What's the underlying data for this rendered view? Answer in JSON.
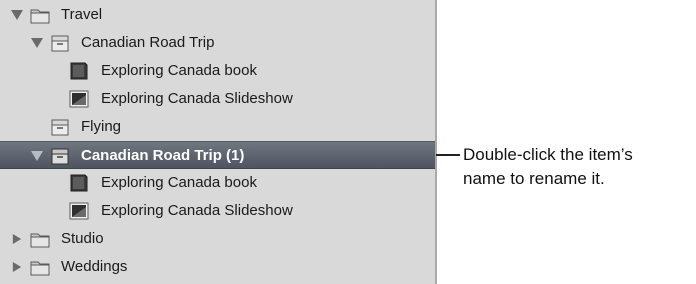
{
  "tree": {
    "items": [
      {
        "label": "Travel",
        "icon": "folder-icon",
        "expander": "expanded"
      },
      {
        "label": "Canadian Road Trip",
        "icon": "project-box-icon",
        "expander": "expanded"
      },
      {
        "label": "Exploring Canada book",
        "icon": "book-icon",
        "expander": "none"
      },
      {
        "label": "Exploring Canada Slideshow",
        "icon": "slideshow-icon",
        "expander": "none"
      },
      {
        "label": "Flying",
        "icon": "project-box-icon",
        "expander": "none"
      },
      {
        "label": "Canadian Road Trip (1)",
        "icon": "project-box-icon",
        "expander": "expanded",
        "selected": true
      },
      {
        "label": "Exploring Canada book",
        "icon": "book-icon",
        "expander": "none"
      },
      {
        "label": "Exploring Canada Slideshow",
        "icon": "slideshow-icon",
        "expander": "none"
      },
      {
        "label": "Studio",
        "icon": "folder-icon",
        "expander": "collapsed"
      },
      {
        "label": "Weddings",
        "icon": "folder-icon",
        "expander": "collapsed"
      }
    ]
  },
  "callout": {
    "text": "Double-click the item’s\nname to rename it."
  },
  "colors": {
    "panel_bg": "#d9d9d9",
    "selection": "#5e656e"
  }
}
